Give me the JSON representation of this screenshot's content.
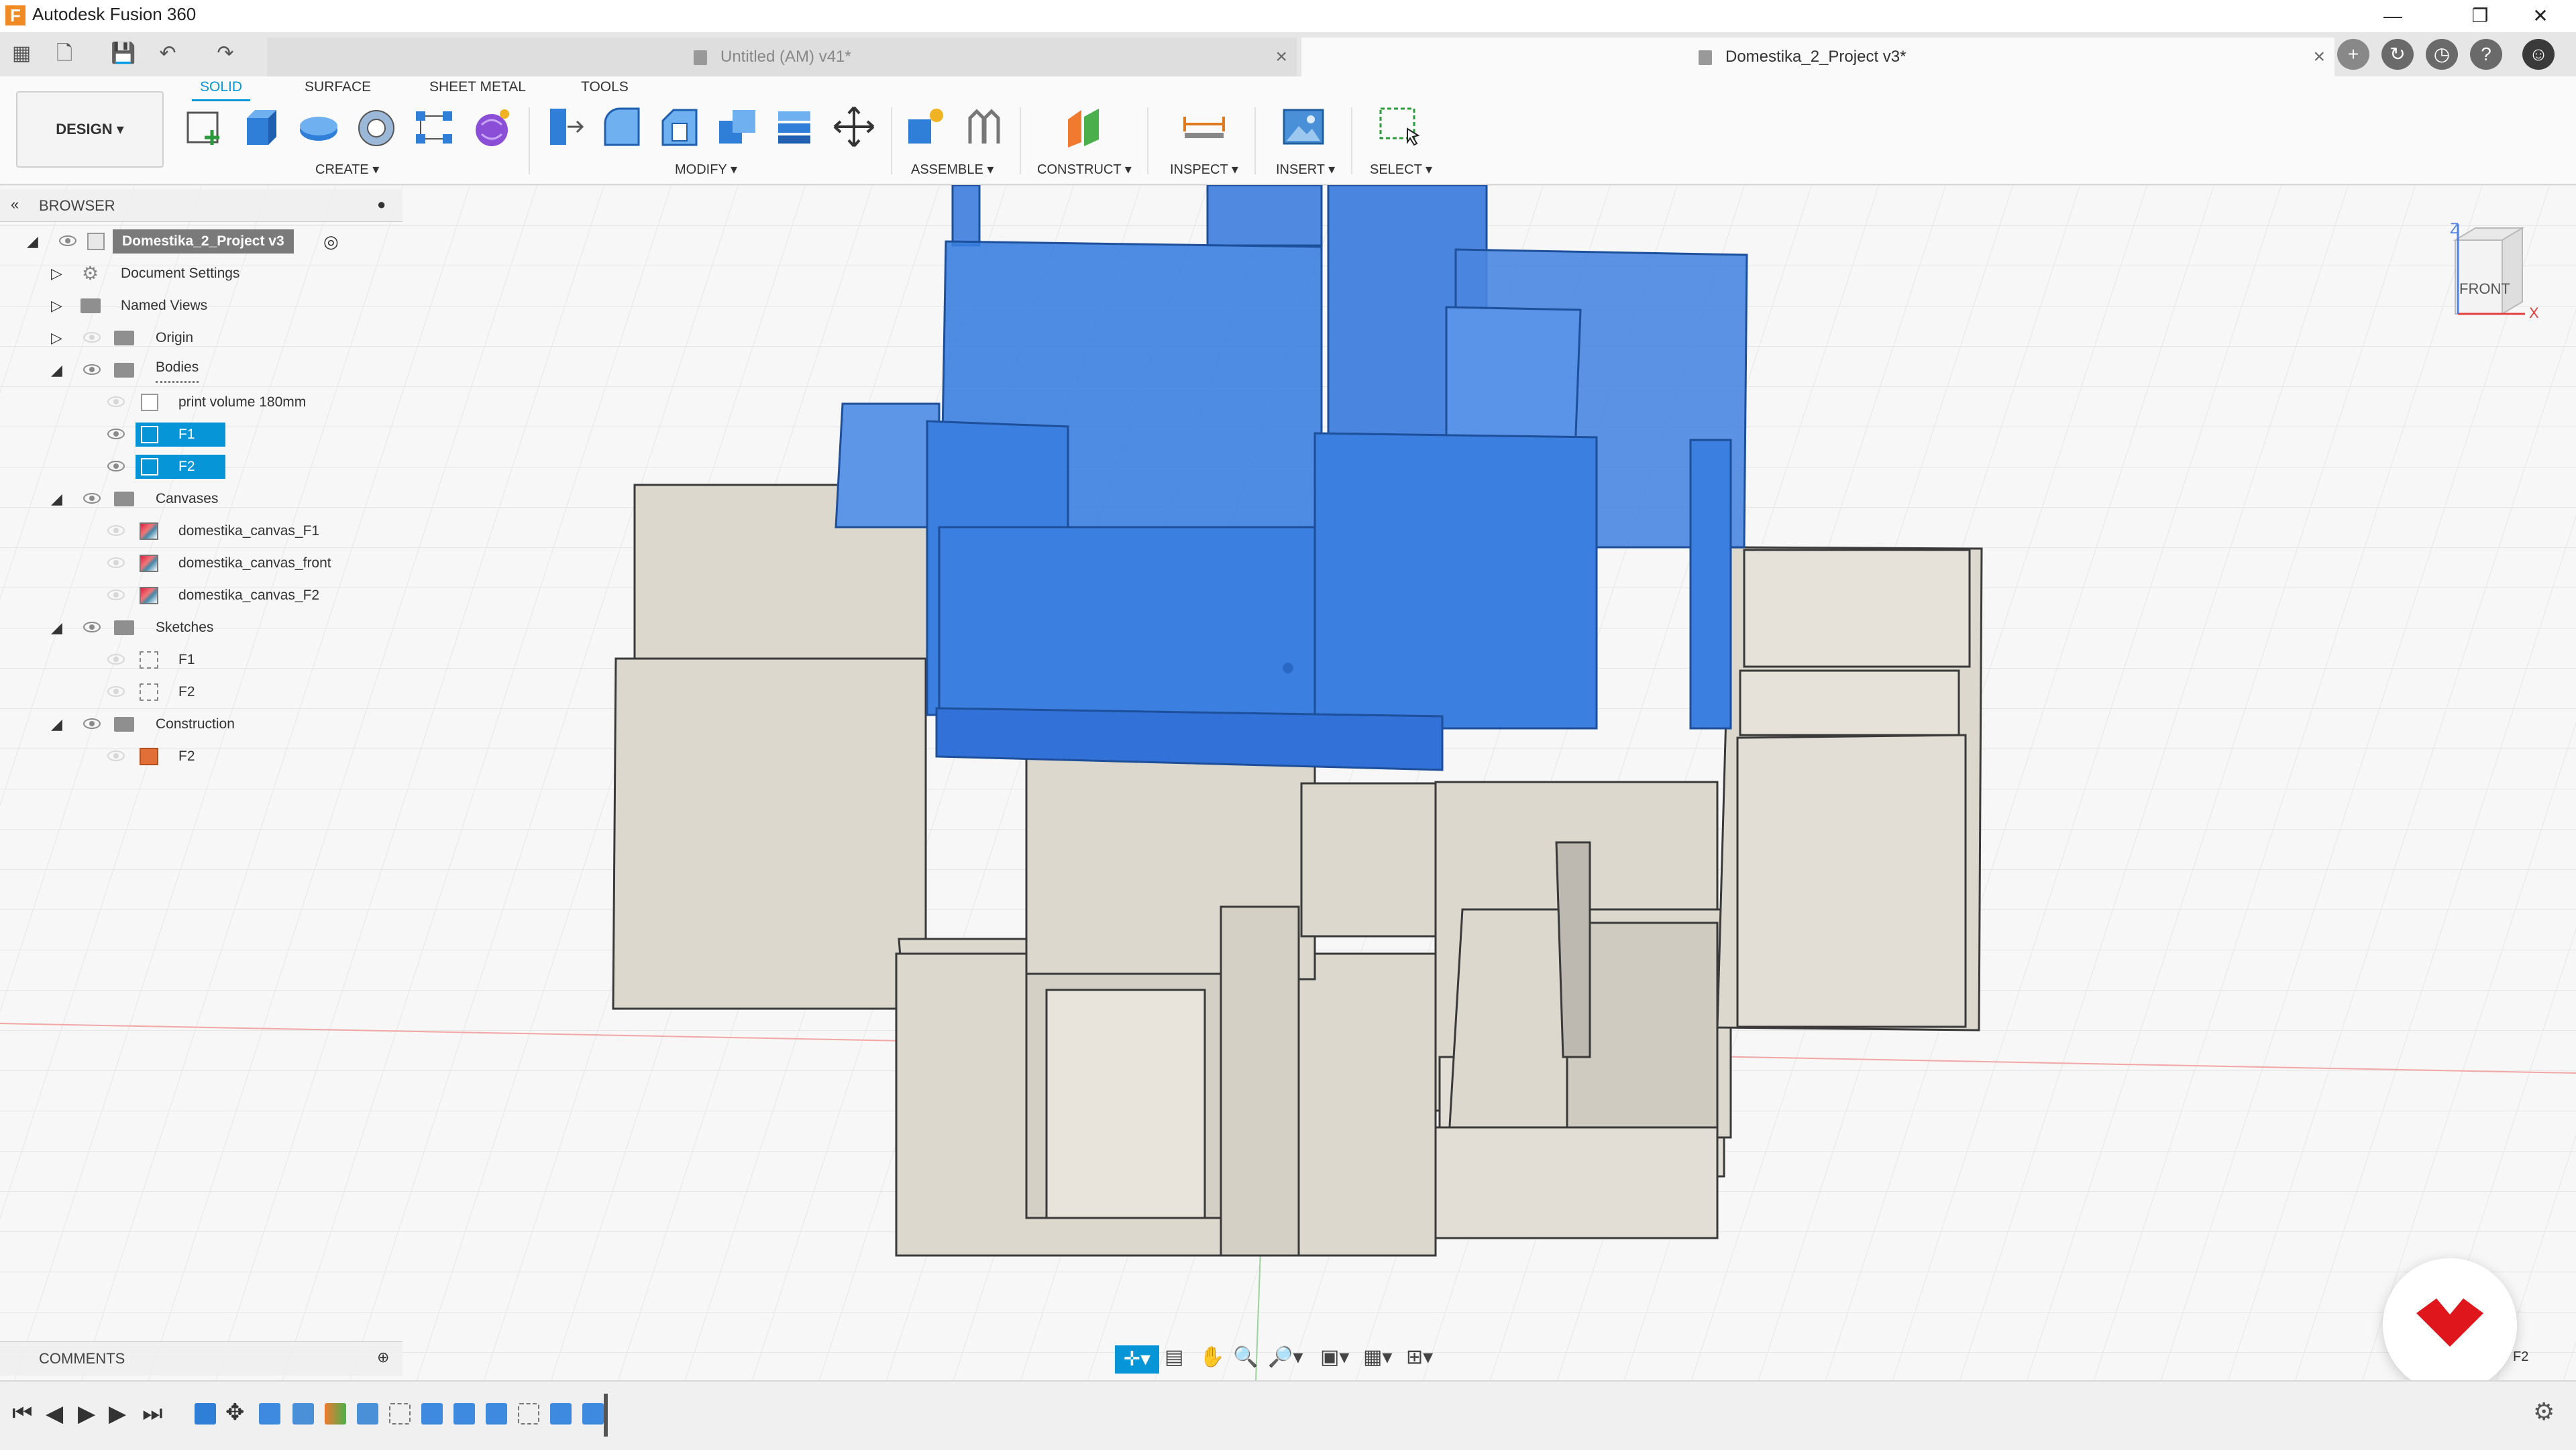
{
  "window": {
    "title": "Autodesk Fusion 360",
    "controls": [
      "minimize-icon",
      "restore-icon",
      "close-icon"
    ]
  },
  "tabs": [
    {
      "label": "Untitled (AM) v41*",
      "active": false
    },
    {
      "label": "Domestika_2_Project v3*",
      "active": true
    }
  ],
  "toolbar": {
    "design_label": "DESIGN",
    "workspace_tabs": [
      "SOLID",
      "SURFACE",
      "SHEET METAL",
      "TOOLS"
    ],
    "groups": [
      "CREATE",
      "MODIFY",
      "ASSEMBLE",
      "CONSTRUCT",
      "INSPECT",
      "INSERT",
      "SELECT"
    ]
  },
  "browser": {
    "header": "BROWSER",
    "root": "Domestika_2_Project v3",
    "items": [
      {
        "label": "Document Settings"
      },
      {
        "label": "Named Views"
      },
      {
        "label": "Origin"
      },
      {
        "label": "Bodies"
      },
      {
        "label": "print volume 180mm"
      },
      {
        "label": "F1"
      },
      {
        "label": "F2"
      },
      {
        "label": "Canvases"
      },
      {
        "label": "domestika_canvas_F1"
      },
      {
        "label": "domestika_canvas_front"
      },
      {
        "label": "domestika_canvas_F2"
      },
      {
        "label": "Sketches"
      },
      {
        "label": "F1"
      },
      {
        "label": "F2"
      },
      {
        "label": "Construction"
      },
      {
        "label": "F2"
      }
    ]
  },
  "comments": {
    "label": "COMMENTS"
  },
  "viewcube": {
    "face": "FRONT",
    "axis_z": "Z",
    "axis_x": "X"
  },
  "corner_label": "F2",
  "colors": {
    "accent": "#0696d7",
    "selected_body": "#3b7fe0",
    "body": "#dcd8ce",
    "logo": "#e0161d"
  }
}
